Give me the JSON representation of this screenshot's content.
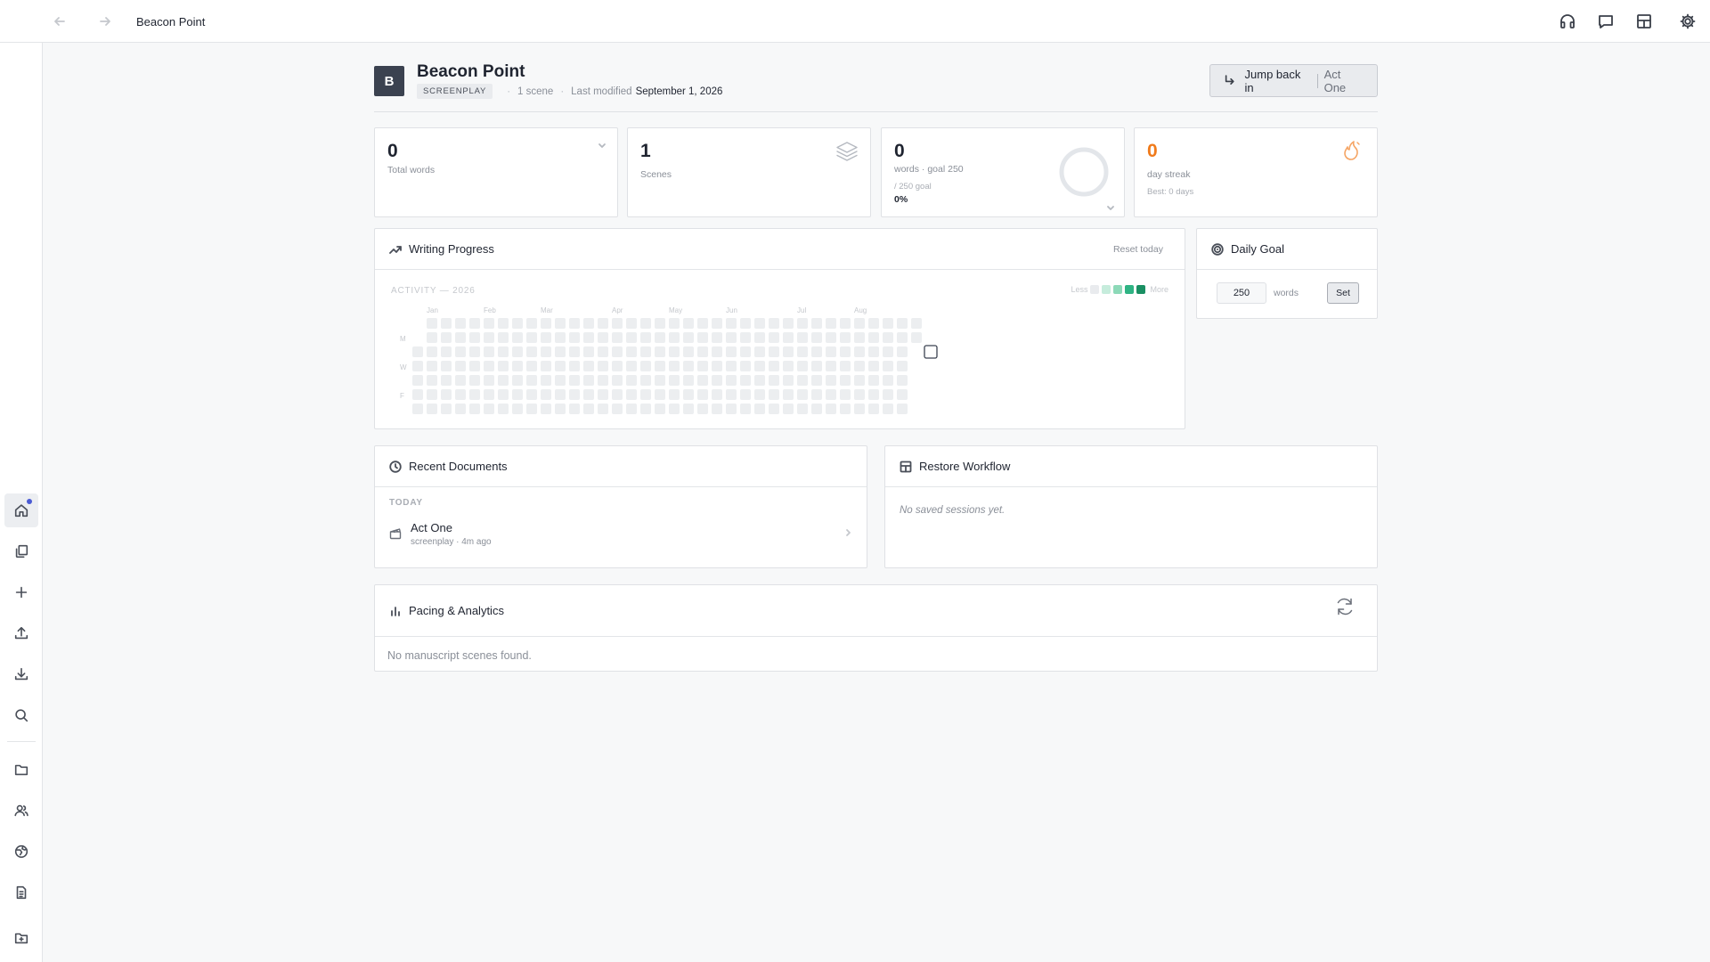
{
  "topbar": {
    "title": "Beacon Point",
    "icons": [
      "arrow-left-icon",
      "arrow-right-icon",
      "headphones-icon",
      "chat-icon",
      "layout-icon",
      "gear-icon"
    ]
  },
  "sidebar": {
    "items": [
      {
        "name": "home",
        "icon": "home-icon",
        "active": true,
        "notification": true
      },
      {
        "name": "documents",
        "icon": "copy-icon"
      },
      {
        "name": "new",
        "icon": "plus-icon"
      },
      {
        "name": "upload",
        "icon": "upload-icon"
      },
      {
        "name": "download",
        "icon": "download-icon"
      },
      {
        "name": "search",
        "icon": "search-icon"
      },
      {
        "name": "folder",
        "icon": "folder-icon"
      },
      {
        "name": "people",
        "icon": "users-icon"
      },
      {
        "name": "world",
        "icon": "globe-icon"
      },
      {
        "name": "notes",
        "icon": "file-text-icon"
      },
      {
        "name": "import",
        "icon": "folder-plus-icon"
      }
    ]
  },
  "project": {
    "initial": "B",
    "title": "Beacon Point",
    "type": "SCREENPLAY",
    "scene_count": "1 scene",
    "modified_label": "Last modified",
    "modified_date": "September 1, 2026"
  },
  "jump": {
    "label": "Jump back in",
    "document": "Act One"
  },
  "stats": {
    "total_words": {
      "value": "0",
      "label": "Total words"
    },
    "scenes": {
      "value": "1",
      "label": "Scenes"
    },
    "goal": {
      "value": "0",
      "label": "words · goal 250",
      "sub": "/ 250 goal",
      "percent": "0%",
      "progress": 0
    },
    "streak": {
      "value": "0",
      "label": "day streak",
      "best": "Best: 0 days"
    }
  },
  "writing_progress": {
    "title": "Writing Progress",
    "reset_label": "Reset today",
    "activity_label": "ACTIVITY — 2026",
    "legend_less": "Less",
    "legend_more": "More",
    "legend_colors": [
      "#e9ebee",
      "#c6ecdc",
      "#8dd9b8",
      "#2fb383",
      "#1a8f63"
    ],
    "months": [
      "Jan",
      "Feb",
      "Mar",
      "Apr",
      "May",
      "Jun",
      "Jul",
      "Aug"
    ],
    "day_labels": [
      "M",
      "W",
      "F"
    ],
    "cell_color": "#eceef0",
    "today_border": "#3b4250"
  },
  "daily_goal": {
    "title": "Daily Goal",
    "value": "250",
    "unit": "words",
    "set_label": "Set"
  },
  "recent_documents": {
    "title": "Recent Documents",
    "group_label": "TODAY",
    "items": [
      {
        "name": "Act One",
        "meta": "screenplay · 4m ago",
        "icon": "clapperboard-icon"
      }
    ]
  },
  "restore_workflow": {
    "title": "Restore Workflow",
    "empty": "No saved sessions yet."
  },
  "pacing": {
    "title": "Pacing & Analytics",
    "empty": "No manuscript scenes found."
  },
  "colors": {
    "accent": "#3b4250",
    "streak": "#f07a1a",
    "green": "#1a8f63"
  }
}
